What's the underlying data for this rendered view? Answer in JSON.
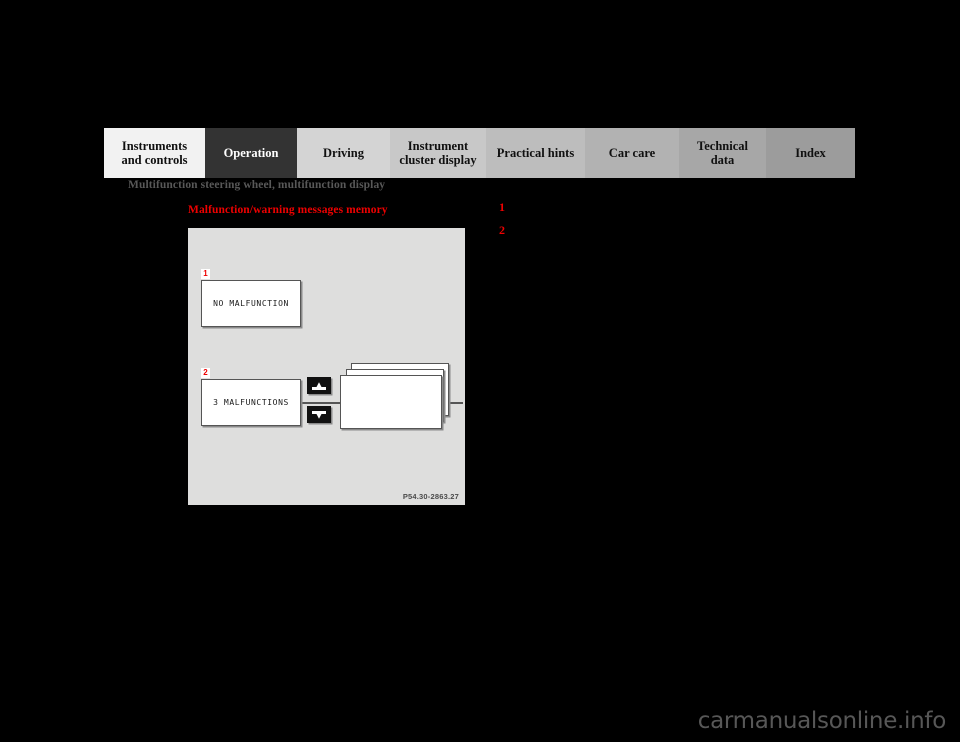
{
  "page": {
    "background_color": "#000000",
    "section_title": "Multifunction steering wheel, multifunction display",
    "sub_heading": "Malfunction/warning messages memory",
    "watermark": "carmanualsonline.info"
  },
  "tab_bar": {
    "active_index": 1,
    "tabs": [
      {
        "label": "Instruments and controls",
        "line1": "Instruments",
        "line2": "and controls",
        "bg": "#f2f2f2",
        "active": false
      },
      {
        "label": "Operation",
        "line1": "Operation",
        "line2": "",
        "bg": "#333333",
        "active": true
      },
      {
        "label": "Driving",
        "line1": "Driving",
        "line2": "",
        "bg": "#d4d4d4",
        "active": false
      },
      {
        "label": "Instrument cluster display",
        "line1": "Instrument",
        "line2": "cluster display",
        "bg": "#c8c8c8",
        "active": false
      },
      {
        "label": "Practical hints",
        "line1": "Practical hints",
        "line2": "",
        "bg": "#bdbdbd",
        "active": false
      },
      {
        "label": "Car care",
        "line1": "Car care",
        "line2": "",
        "bg": "#b2b2b2",
        "active": false
      },
      {
        "label": "Technical data",
        "line1": "Technical",
        "line2": "data",
        "bg": "#a7a7a7",
        "active": false
      },
      {
        "label": "Index",
        "line1": "Index",
        "line2": "",
        "bg": "#9c9c9c",
        "active": false
      }
    ]
  },
  "legend": {
    "items": [
      {
        "number": "1",
        "text": ""
      },
      {
        "number": "2",
        "text": ""
      }
    ]
  },
  "figure": {
    "caption": "P54.30-2863.27",
    "background_color": "#dededd",
    "callouts": [
      {
        "number": "1"
      },
      {
        "number": "2"
      }
    ],
    "displays": [
      {
        "callout": "1",
        "text": "NO MALFUNCTION"
      },
      {
        "callout": "2",
        "text": "3 MALFUNCTIONS"
      }
    ],
    "buttons": [
      {
        "name": "scroll-up",
        "glyph": "up-arrow"
      },
      {
        "name": "scroll-down",
        "glyph": "down-arrow"
      }
    ],
    "stack_pages": 3
  },
  "colors": {
    "red_accent": "#ee0000",
    "active_tab": "#333333",
    "figure_bg": "#dededd",
    "page_bg": "#000000"
  }
}
